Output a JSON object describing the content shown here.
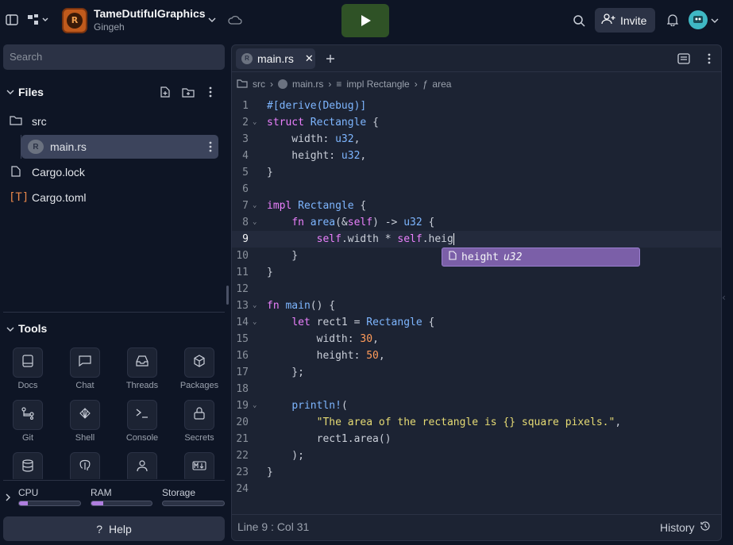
{
  "header": {
    "app_title": "TameDutifulGraphics",
    "owner": "Gingeh",
    "avatar_glyph": "R",
    "invite_label": "Invite"
  },
  "sidebar": {
    "search_placeholder": "Search",
    "files_title": "Files",
    "files": [
      {
        "name": "src",
        "icon": "folder-icon"
      },
      {
        "name": "main.rs",
        "icon": "rust-icon"
      },
      {
        "name": "Cargo.lock",
        "icon": "file-icon"
      },
      {
        "name": "Cargo.toml",
        "icon": "toml-icon"
      }
    ],
    "tools_title": "Tools",
    "tools": [
      {
        "label": "Docs"
      },
      {
        "label": "Chat"
      },
      {
        "label": "Threads"
      },
      {
        "label": "Packages"
      },
      {
        "label": "Git"
      },
      {
        "label": "Shell"
      },
      {
        "label": "Console"
      },
      {
        "label": "Secrets"
      }
    ],
    "resources": [
      {
        "label": "CPU",
        "level": 0.14
      },
      {
        "label": "RAM",
        "level": 0.2
      },
      {
        "label": "Storage",
        "level": 0.0
      }
    ],
    "help_label": "Help"
  },
  "editor": {
    "tab_label": "main.rs",
    "breadcrumb": [
      "src",
      "main.rs",
      "impl Rectangle",
      "area"
    ],
    "status": "Line 9 : Col 31",
    "history_label": "History",
    "suggestion": {
      "name": "height",
      "type": "u32"
    },
    "colors": {
      "keyword": "#ea80fc",
      "type": "#7eb6ff",
      "number": "#ff9b5a",
      "string": "#e6db74",
      "accent": "#7b5fa8"
    }
  }
}
